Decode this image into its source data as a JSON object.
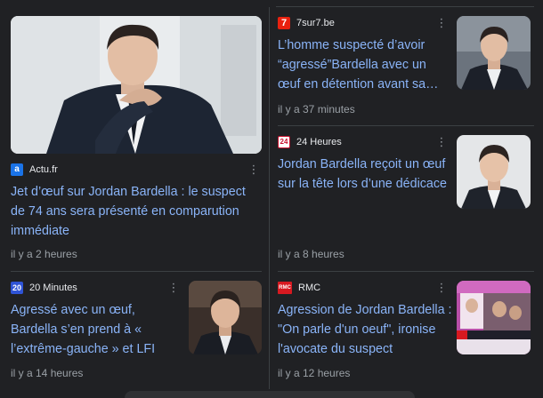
{
  "articles": [
    {
      "source": "Actu.fr",
      "logo_glyph": "a",
      "logo_color": "#1a73e8",
      "title": "Jet d’œuf sur Jordan Bardella : le suspect de 74 ans sera présenté en comparution immédiate",
      "time": "il y a 2 heures",
      "menu_glyph": "⋮"
    },
    {
      "source": "7sur7.be",
      "logo_glyph": "7",
      "logo_color": "#e8210f",
      "title": "L’homme suspecté d’avoir “agressé”Bardella avec un œuf en détention avant sa…",
      "time": "il y a 37 minutes",
      "menu_glyph": "⋮"
    },
    {
      "source": "24 Heures",
      "logo_glyph": "24",
      "logo_color": "#ffffff",
      "title": "Jordan Bardella reçoit un œuf sur la tête lors d’une dédicace",
      "time": "il y a 8 heures",
      "menu_glyph": "⋮"
    },
    {
      "source": "20 Minutes",
      "logo_glyph": "20",
      "logo_color": "#2f54d6",
      "title": "Agressé avec un œuf, Bardella s’en prend à « l’extrême-gauche » et LFI",
      "time": "il y a 14 heures",
      "menu_glyph": "⋮"
    },
    {
      "source": "RMC",
      "logo_glyph": "RMC",
      "logo_color": "#d71920",
      "title": "Agression de Jordan Bardella : \"On parle d'un oeuf\", ironise l'avocate du suspect",
      "time": "il y a 12 heures",
      "menu_glyph": "⋮"
    }
  ]
}
